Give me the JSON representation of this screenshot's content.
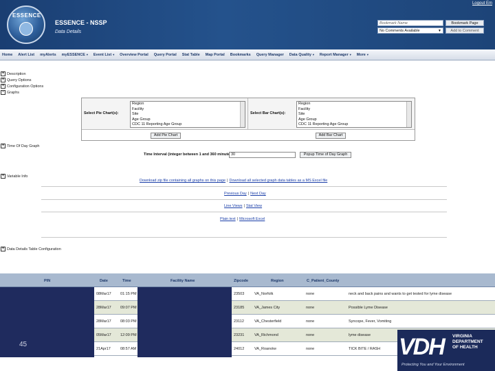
{
  "header": {
    "logo_text": "ESSENCE",
    "title": "ESSENCE - NSSP",
    "subtitle": "Data Details",
    "logout": "Logout Em",
    "bookmark_placeholder": "Bookmark Name",
    "bookmark_button": "Bookmark Page",
    "comments_select": "No Comments Available",
    "add_comment": "Add to Comment"
  },
  "nav": [
    {
      "label": "Home",
      "caret": ""
    },
    {
      "label": "Alert List",
      "caret": ""
    },
    {
      "label": "myAlerts",
      "caret": ""
    },
    {
      "label": "myESSENCE",
      "caret": "▼"
    },
    {
      "label": "Event List",
      "caret": "▼"
    },
    {
      "label": "Overview Portal",
      "caret": ""
    },
    {
      "label": "Query Portal",
      "caret": ""
    },
    {
      "label": "Stat Table",
      "caret": ""
    },
    {
      "label": "Map Portal",
      "caret": ""
    },
    {
      "label": "Bookmarks",
      "caret": ""
    },
    {
      "label": "Query Manager",
      "caret": ""
    },
    {
      "label": "Data Quality",
      "caret": "▼"
    },
    {
      "label": "Report Manager",
      "caret": "▼"
    },
    {
      "label": "More",
      "caret": "▼"
    }
  ],
  "sections": {
    "description": "Description",
    "query_options": "Query Options",
    "configuration": "Configuration Options",
    "graphs": "Graphs",
    "time_of_day": "Time Of Day Graph",
    "variable_info": "Variable Info",
    "table_config": "Data Details Table Configuration"
  },
  "graphs": {
    "pie_label": "Select Pie Chart(s):",
    "bar_label": "Select Bar Chart(s):",
    "options": [
      "Region",
      "Facility",
      "Site",
      "Age Group",
      "CDC 11 Reporting Age Group"
    ],
    "add_pie": "Add Pie Chart",
    "add_bar": "Add Bar Chart"
  },
  "time_of_day": {
    "label": "Time Interval (integer between 1 and 360 minutes):",
    "value": "30",
    "button": "Popup Time of Day Graph"
  },
  "links": {
    "download_zip": "Download zip file containing all graphs on this page",
    "download_excel": "Download all selected graph data tables as a MS Excel file",
    "prev_day": "Previous Day",
    "next_day": "Next Day",
    "line_views": "Line Views",
    "stat_view": "Stat View",
    "plain_text": "Plain text",
    "microsoft_excel": "Microsoft Excel"
  },
  "table": {
    "columns": [
      "PIN",
      "Date",
      "Time",
      "Facility Name",
      "Zipcode",
      "Region",
      "C_Patient_County"
    ],
    "rows": [
      {
        "date": "08Mar17",
        "time": "01:15 PM",
        "zip": "23503",
        "region": "VA_Norfolk",
        "county": "none",
        "complaint": "neck and back pains and wants to get tested for lyme disease"
      },
      {
        "date": "28Mar17",
        "time": "09:07 PM",
        "zip": "23185",
        "region": "VA_James City",
        "county": "none",
        "complaint": "Possible Lyme Disease"
      },
      {
        "date": "28Mar17",
        "time": "08:03 PM",
        "zip": "23112",
        "region": "VA_Chesterfield",
        "county": "none",
        "complaint": "Syncope, Fever, Vomiting"
      },
      {
        "date": "05Mar17",
        "time": "12:09 PM",
        "zip": "23231",
        "region": "VA_Richmond",
        "county": "none",
        "complaint": "lyme disease"
      },
      {
        "date": "21Apr17",
        "time": "08:57 AM",
        "zip": "24012",
        "region": "VA_Roanoke",
        "county": "none",
        "complaint": "TICK BITE / RASH"
      }
    ]
  },
  "slide_number": "45",
  "vdh": {
    "big": "VDH",
    "line1": "VIRGINIA",
    "line2": "DEPARTMENT",
    "line3": "OF HEALTH",
    "tagline": "Protecting You and Your Environment"
  }
}
